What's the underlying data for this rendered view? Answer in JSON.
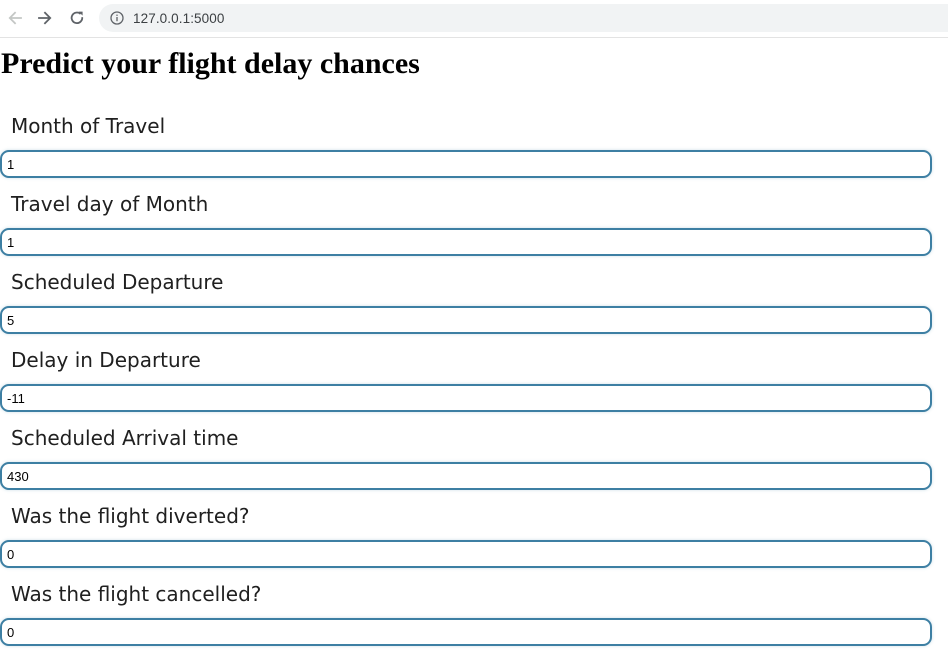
{
  "browser": {
    "url": "127.0.0.1:5000",
    "icons": {
      "back": "back-arrow-icon",
      "forward": "forward-arrow-icon",
      "reload": "reload-icon",
      "site_info": "info-icon"
    }
  },
  "page": {
    "title": "Predict your flight delay chances"
  },
  "form": {
    "fields": [
      {
        "label": "Month of Travel",
        "value": "1"
      },
      {
        "label": "Travel day of Month",
        "value": "1"
      },
      {
        "label": "Scheduled Departure",
        "value": "5"
      },
      {
        "label": "Delay in Departure",
        "value": "-11"
      },
      {
        "label": "Scheduled Arrival time",
        "value": "430"
      },
      {
        "label": "Was the flight diverted?",
        "value": "0"
      },
      {
        "label": "Was the flight cancelled?",
        "value": "0"
      }
    ]
  },
  "colors": {
    "input_border": "#3d7fa3",
    "omnibox_bg": "#f1f3f4"
  }
}
